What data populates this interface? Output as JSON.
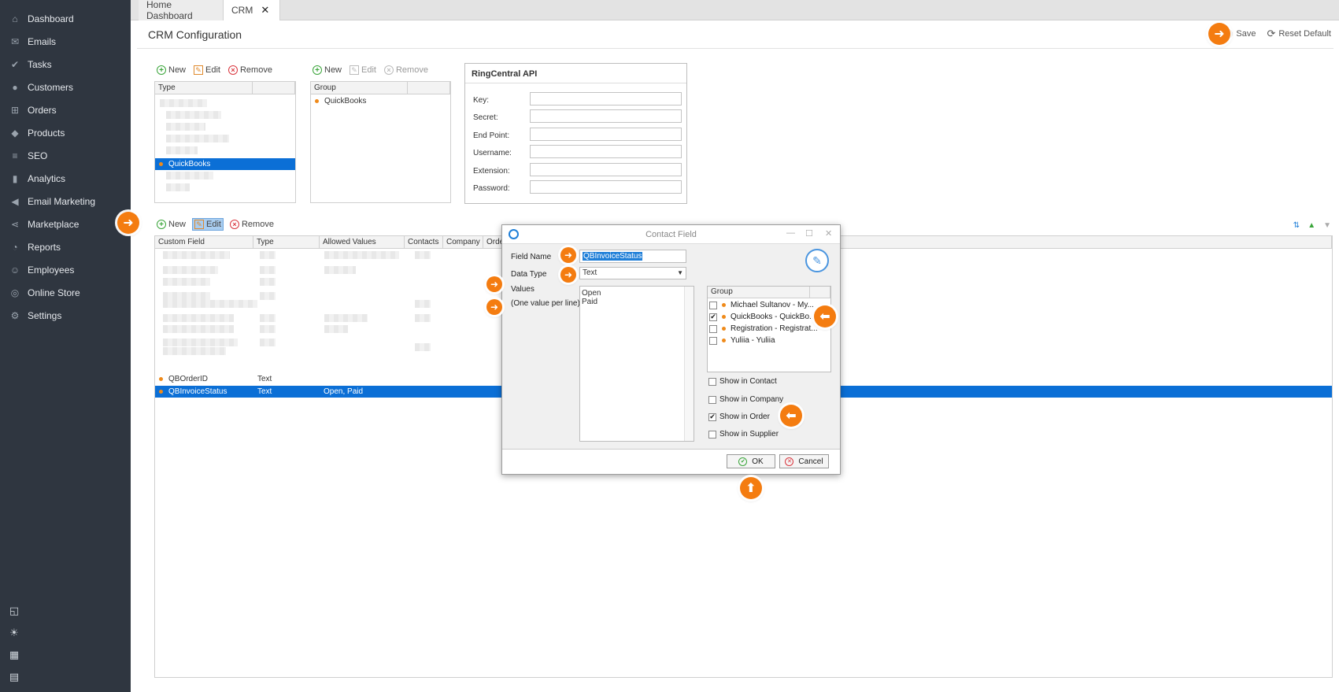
{
  "sidebar": {
    "items": [
      {
        "label": "Dashboard",
        "icon": "⌂"
      },
      {
        "label": "Emails",
        "icon": "✉"
      },
      {
        "label": "Tasks",
        "icon": "✔"
      },
      {
        "label": "Customers",
        "icon": "●"
      },
      {
        "label": "Orders",
        "icon": "⊞"
      },
      {
        "label": "Products",
        "icon": "◆"
      },
      {
        "label": "SEO",
        "icon": "≡"
      },
      {
        "label": "Analytics",
        "icon": "▮"
      },
      {
        "label": "Email Marketing",
        "icon": "◀"
      },
      {
        "label": "Marketplace",
        "icon": "⋖"
      },
      {
        "label": "Reports",
        "icon": "◔"
      },
      {
        "label": "Employees",
        "icon": "☺"
      },
      {
        "label": "Online Store",
        "icon": "◎"
      },
      {
        "label": "Settings",
        "icon": "⚙"
      }
    ],
    "bottom_icons": [
      "◱",
      "☀",
      "▦",
      "▤"
    ]
  },
  "tabs": [
    {
      "label": "Home Dashboard"
    },
    {
      "label": "CRM",
      "close": "✕"
    }
  ],
  "header": {
    "title": "CRM Configuration",
    "save_label": "Save",
    "reset_label": "Reset Default"
  },
  "toolbar": {
    "new": "New",
    "edit": "Edit",
    "remove": "Remove"
  },
  "type_grid": {
    "header": "Type",
    "selected_row": "QuickBooks"
  },
  "group_grid": {
    "header": "Group",
    "rows": [
      "QuickBooks"
    ]
  },
  "ringcentral": {
    "title": "RingCentral API",
    "fields": [
      "Key:",
      "Secret:",
      "End Point:",
      "Username:",
      "Extension:",
      "Password:"
    ]
  },
  "custom_grid": {
    "headers": [
      "Custom Field",
      "Type",
      "Allowed Values",
      "Contacts",
      "Company",
      "Orde"
    ],
    "rows": [
      {
        "field": "QBOrderID",
        "type": "Text",
        "values": ""
      },
      {
        "field": "QBInvoiceStatus",
        "type": "Text",
        "values": "Open, Paid"
      }
    ]
  },
  "dialog": {
    "title": "Contact Field",
    "field_name_label": "Field Name",
    "field_name_value": "QBInvoiceStatus",
    "data_type_label": "Data Type",
    "data_type_value": "Text",
    "values_label": "Values",
    "values_hint": "(One value per line)",
    "values": [
      "Open",
      "Paid"
    ],
    "group_header": "Group",
    "groups": [
      {
        "label": "Michael Sultanov - My...",
        "checked": false
      },
      {
        "label": "QuickBooks - QuickBo...",
        "checked": true
      },
      {
        "label": "Registration - Registrat...",
        "checked": false
      },
      {
        "label": "Yuliia - Yuliia",
        "checked": false
      }
    ],
    "show_contact": "Show in Contact",
    "show_company": "Show in Company",
    "show_order": "Show in Order",
    "show_supplier": "Show in Supplier",
    "ok": "OK",
    "cancel": "Cancel"
  },
  "colors": {
    "accent": "#0b6fd6",
    "marker": "#f47c10",
    "sidebar": "#2f3640"
  }
}
